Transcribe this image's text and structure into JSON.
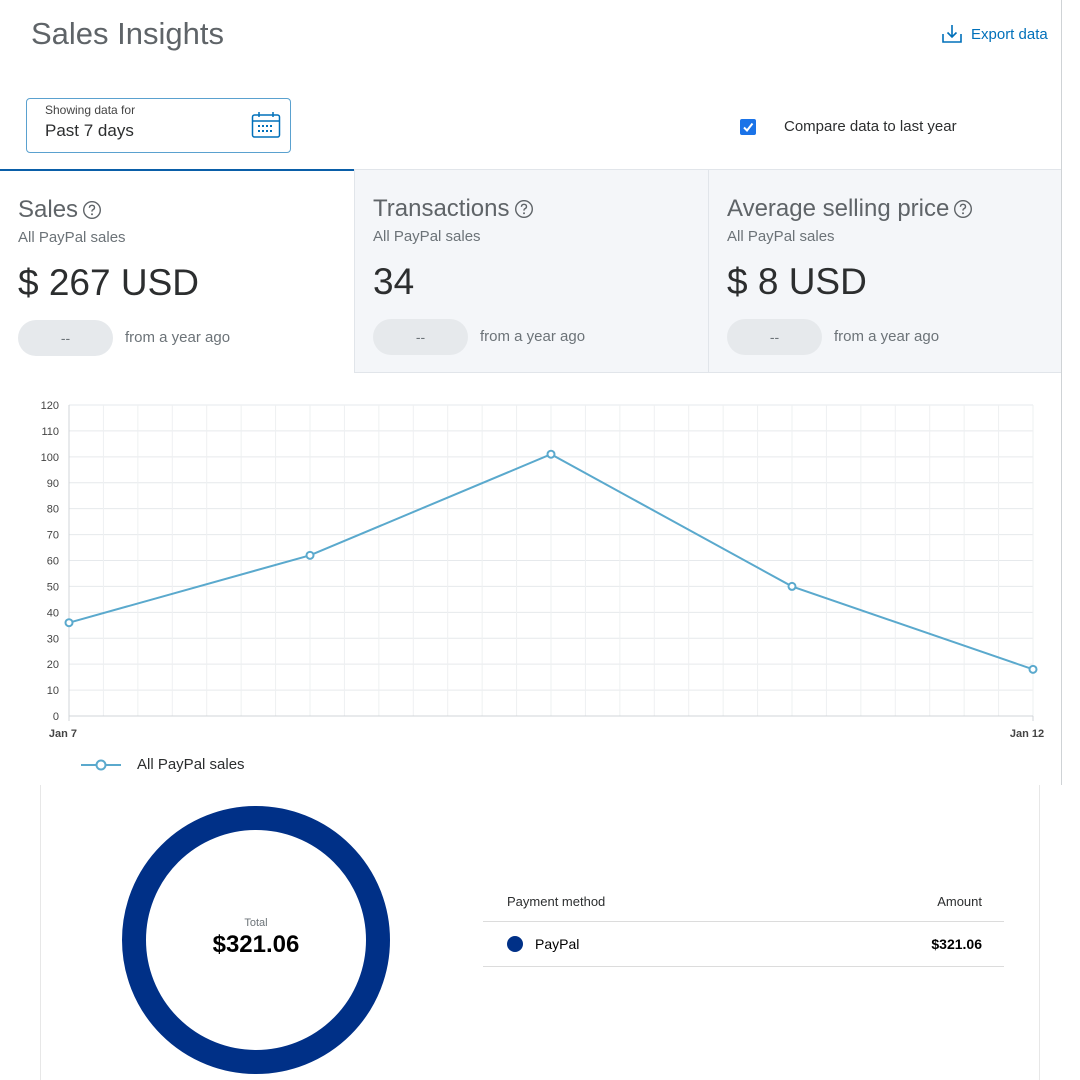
{
  "header": {
    "title": "Sales Insights",
    "export_label": "Export data"
  },
  "date_filter": {
    "caption": "Showing data for",
    "value": "Past 7 days"
  },
  "compare": {
    "label": "Compare data to last year",
    "checked": true
  },
  "cards": [
    {
      "title": "Sales",
      "subtitle": "All PayPal sales",
      "value": "$ 267 USD",
      "change": "--",
      "change_note": "from a year ago"
    },
    {
      "title": "Transactions",
      "subtitle": "All PayPal sales",
      "value": "34",
      "change": "--",
      "change_note": "from a year ago"
    },
    {
      "title": "Average selling price",
      "subtitle": "All PayPal sales",
      "value": "$ 8 USD",
      "change": "--",
      "change_note": "from a year ago"
    }
  ],
  "chart_data": {
    "type": "line",
    "x": [
      0,
      1,
      2,
      3,
      4
    ],
    "x_tick_labels": [
      {
        "x": 0,
        "label": "Jan 7"
      },
      {
        "x": 4,
        "label": "Jan 12"
      }
    ],
    "series": [
      {
        "name": "All PayPal sales",
        "values": [
          36,
          62,
          101,
          50,
          18
        ],
        "color": "#5aa9cd"
      }
    ],
    "ylim": [
      0,
      120
    ],
    "yticks": [
      0,
      10,
      20,
      30,
      40,
      50,
      60,
      70,
      80,
      90,
      100,
      110,
      120
    ],
    "grid": true,
    "legend": "bottom-left"
  },
  "payment": {
    "total_label": "Total",
    "total_value": "$321.06",
    "donut_color": "#003087",
    "columns": {
      "method": "Payment method",
      "amount": "Amount"
    },
    "rows": [
      {
        "method": "PayPal",
        "amount": "$321.06",
        "color": "#003087"
      }
    ]
  }
}
